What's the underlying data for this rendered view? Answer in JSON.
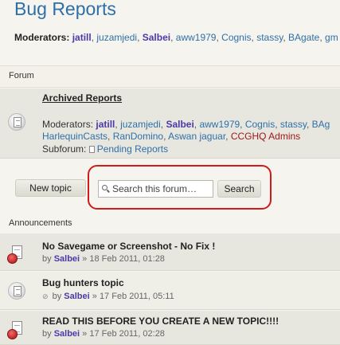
{
  "page": {
    "title": "Bug Reports",
    "moderators_label": "Moderators:",
    "moderators": [
      {
        "name": "jatill",
        "style": "bold"
      },
      {
        "name": "juzamjedi",
        "style": "normal"
      },
      {
        "name": "Salbei",
        "style": "bold"
      },
      {
        "name": "aww1979",
        "style": "normal"
      },
      {
        "name": "Cognis",
        "style": "normal"
      },
      {
        "name": "stassy",
        "style": "normal"
      },
      {
        "name": "BAgate",
        "style": "normal"
      },
      {
        "name": "gm",
        "style": "normal"
      }
    ]
  },
  "forum_section": {
    "header": "Forum",
    "archived": {
      "title": "Archived Reports",
      "moderators_label": "Moderators:",
      "moderators_line1": [
        {
          "name": "jatill",
          "style": "bold"
        },
        {
          "name": "juzamjedi",
          "style": "normal"
        },
        {
          "name": "Salbei",
          "style": "bold"
        },
        {
          "name": "aww1979",
          "style": "normal"
        },
        {
          "name": "Cognis",
          "style": "normal"
        },
        {
          "name": "stassy",
          "style": "normal"
        },
        {
          "name": "BAg",
          "style": "normal"
        }
      ],
      "moderators_line2": [
        {
          "name": "HarlequinCasts",
          "style": "normal"
        },
        {
          "name": "RanDomino",
          "style": "normal"
        },
        {
          "name": "Aswan jaguar",
          "style": "normal"
        },
        {
          "name": "CCGHQ Admins",
          "style": "red"
        }
      ],
      "subforum_label": "Subforum:",
      "subforum_link": "Pending Reports"
    }
  },
  "toolbar": {
    "new_topic_label": "New topic",
    "search_placeholder": "Search this forum…",
    "search_button_label": "Search"
  },
  "announcements": {
    "header": "Announcements",
    "items": [
      {
        "title": "No Savegame or Screenshot - No Fix !",
        "by": "by",
        "author": "Salbei",
        "date": "» 18 Feb 2011, 01:28",
        "icon": "announcement-icon",
        "attachment": false
      },
      {
        "title": "Bug hunters topic",
        "by": "by",
        "author": "Salbei",
        "date": "» 17 Feb 2011, 05:11",
        "icon": "sticky-topic-icon",
        "attachment": true
      },
      {
        "title": "READ THIS BEFORE YOU CREATE A NEW TOPIC!!!!",
        "by": "by",
        "author": "Salbei",
        "date": "» 17 Feb 2011, 02:28",
        "icon": "announcement-icon",
        "attachment": false
      }
    ]
  },
  "colors": {
    "title": "#2f6fa8",
    "link": "#2f6fa8",
    "username_bold": "#4b3aa8",
    "admin_red": "#a01818",
    "annotation_red": "#d11b1b",
    "page_bg": "#f5f4ee"
  }
}
